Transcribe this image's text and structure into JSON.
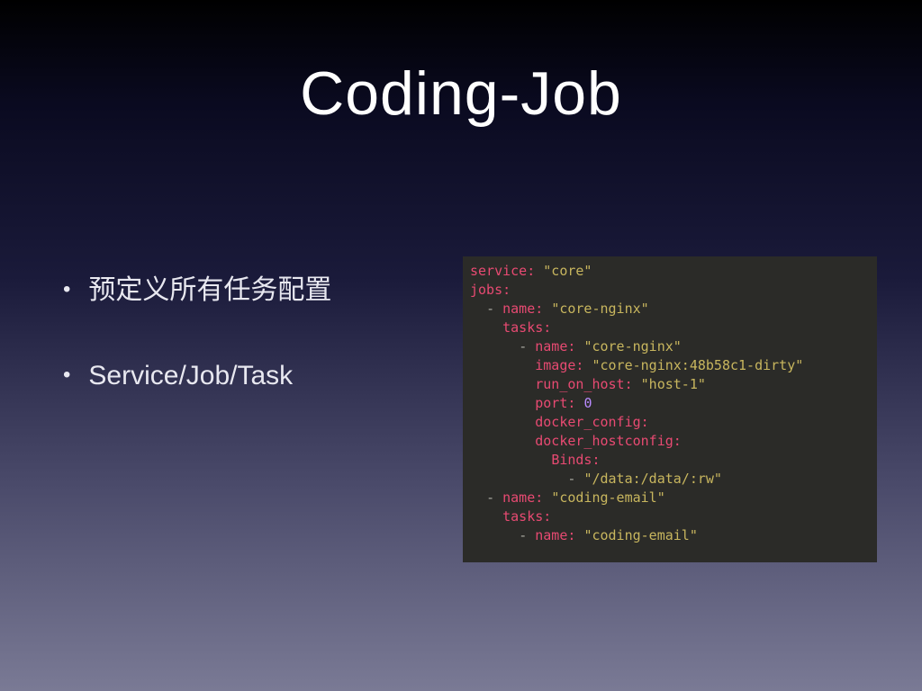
{
  "title": "Coding-Job",
  "bullets": [
    "预定义所有任务配置",
    "Service/Job/Task"
  ],
  "code": {
    "lines": [
      {
        "indent": "",
        "parts": [
          {
            "t": "key",
            "v": "service:"
          },
          {
            "t": "sp",
            "v": " "
          },
          {
            "t": "str",
            "v": "\"core\""
          }
        ]
      },
      {
        "indent": "",
        "parts": [
          {
            "t": "key",
            "v": "jobs:"
          }
        ]
      },
      {
        "indent": "  ",
        "parts": [
          {
            "t": "dash",
            "v": "- "
          },
          {
            "t": "key",
            "v": "name:"
          },
          {
            "t": "sp",
            "v": " "
          },
          {
            "t": "str",
            "v": "\"core-nginx\""
          }
        ]
      },
      {
        "indent": "    ",
        "parts": [
          {
            "t": "key",
            "v": "tasks:"
          }
        ]
      },
      {
        "indent": "      ",
        "parts": [
          {
            "t": "dash",
            "v": "- "
          },
          {
            "t": "key",
            "v": "name:"
          },
          {
            "t": "sp",
            "v": " "
          },
          {
            "t": "str",
            "v": "\"core-nginx\""
          }
        ]
      },
      {
        "indent": "        ",
        "parts": [
          {
            "t": "key",
            "v": "image:"
          },
          {
            "t": "sp",
            "v": " "
          },
          {
            "t": "str",
            "v": "\"core-nginx:48b58c1-dirty\""
          }
        ]
      },
      {
        "indent": "        ",
        "parts": [
          {
            "t": "key",
            "v": "run_on_host:"
          },
          {
            "t": "sp",
            "v": " "
          },
          {
            "t": "str",
            "v": "\"host-1\""
          }
        ]
      },
      {
        "indent": "        ",
        "parts": [
          {
            "t": "key",
            "v": "port:"
          },
          {
            "t": "sp",
            "v": " "
          },
          {
            "t": "num",
            "v": "0"
          }
        ]
      },
      {
        "indent": "        ",
        "parts": [
          {
            "t": "key",
            "v": "docker_config:"
          }
        ]
      },
      {
        "indent": "        ",
        "parts": [
          {
            "t": "key",
            "v": "docker_hostconfig:"
          }
        ]
      },
      {
        "indent": "          ",
        "parts": [
          {
            "t": "key",
            "v": "Binds:"
          }
        ]
      },
      {
        "indent": "            ",
        "parts": [
          {
            "t": "dash",
            "v": "- "
          },
          {
            "t": "str",
            "v": "\"/data:/data/:rw\""
          }
        ]
      },
      {
        "indent": "  ",
        "parts": [
          {
            "t": "dash",
            "v": "- "
          },
          {
            "t": "key",
            "v": "name:"
          },
          {
            "t": "sp",
            "v": " "
          },
          {
            "t": "str",
            "v": "\"coding-email\""
          }
        ]
      },
      {
        "indent": "    ",
        "parts": [
          {
            "t": "key",
            "v": "tasks:"
          }
        ]
      },
      {
        "indent": "      ",
        "parts": [
          {
            "t": "dash",
            "v": "- "
          },
          {
            "t": "key",
            "v": "name:"
          },
          {
            "t": "sp",
            "v": " "
          },
          {
            "t": "str",
            "v": "\"coding-email\""
          }
        ]
      }
    ]
  }
}
